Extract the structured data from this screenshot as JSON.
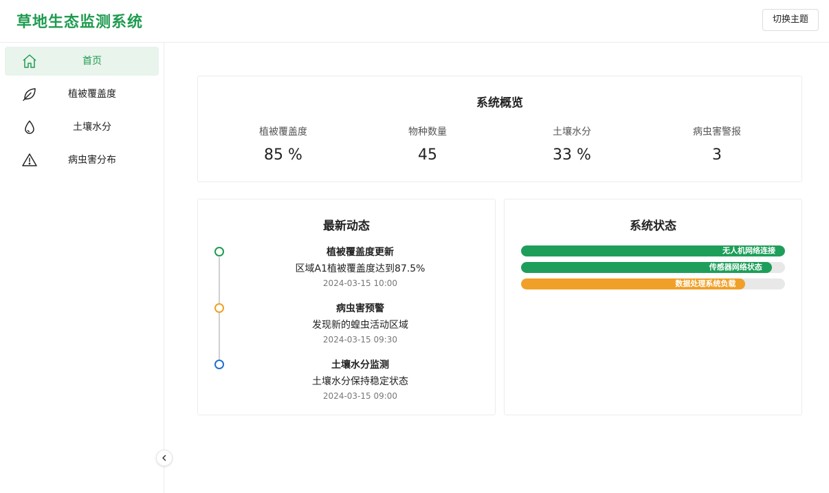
{
  "header": {
    "title": "草地生态监测系统",
    "theme_button": "切换主题"
  },
  "sidebar": {
    "items": [
      {
        "label": "首页",
        "icon": "home-icon",
        "active": true
      },
      {
        "label": "植被覆盖度",
        "icon": "leaf-icon",
        "active": false
      },
      {
        "label": "土壤水分",
        "icon": "droplet-icon",
        "active": false
      },
      {
        "label": "病虫害分布",
        "icon": "warning-icon",
        "active": false
      }
    ],
    "collapse_icon": "chevron-left-icon"
  },
  "overview": {
    "title": "系统概览",
    "stats": [
      {
        "label": "植被覆盖度",
        "value": "85  %"
      },
      {
        "label": "物种数量",
        "value": "45"
      },
      {
        "label": "土壤水分",
        "value": "33  %"
      },
      {
        "label": "病虫害警报",
        "value": "3"
      }
    ]
  },
  "activity": {
    "title": "最新动态",
    "items": [
      {
        "title": "植被覆盖度更新",
        "desc": "区域A1植被覆盖度达到87.5%",
        "time": "2024-03-15 10:00",
        "color": "#1e9b4f"
      },
      {
        "title": "病虫害预警",
        "desc": "发现新的蝗虫活动区域",
        "time": "2024-03-15 09:30",
        "color": "#f0a020"
      },
      {
        "title": "土壤水分监测",
        "desc": "土壤水分保持稳定状态",
        "time": "2024-03-15 09:00",
        "color": "#1f6fd0"
      }
    ]
  },
  "status": {
    "title": "系统状态",
    "bars": [
      {
        "label": "无人机网络连接",
        "percent": 100,
        "color": "#1e9e5a"
      },
      {
        "label": "传感器网络状态",
        "percent": 95,
        "color": "#1e9e5a"
      },
      {
        "label": "数据处理系统负载",
        "percent": 85,
        "color": "#f0a028"
      }
    ]
  },
  "colors": {
    "brand": "#1e9b4f",
    "active_bg": "#e8f4ec"
  }
}
